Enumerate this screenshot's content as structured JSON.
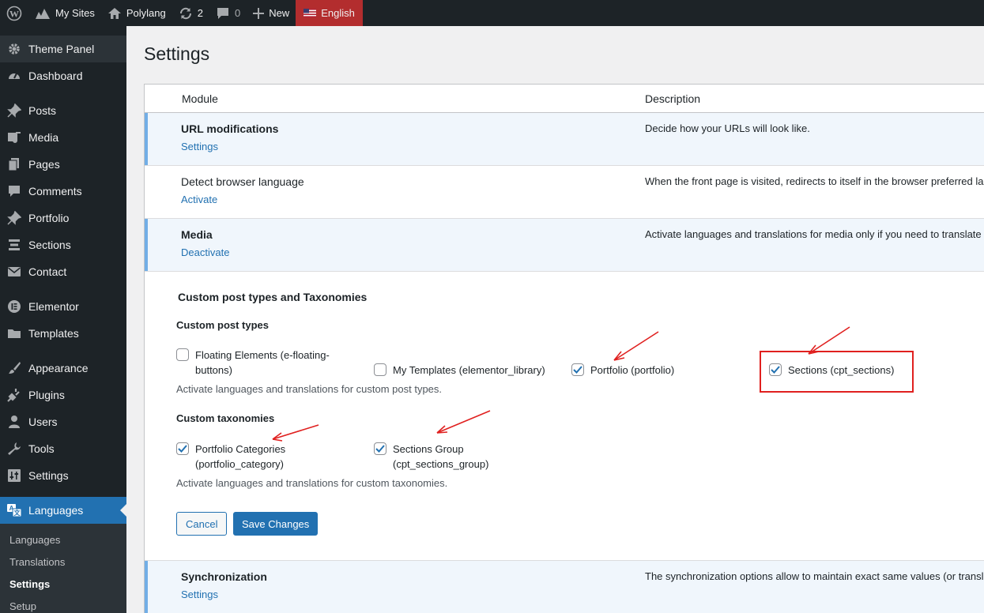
{
  "adminbar": {
    "my_sites": "My Sites",
    "site_name": "Polylang",
    "updates_count": "2",
    "comments_count": "0",
    "new_label": "New",
    "language": "English"
  },
  "sidebar": {
    "items": [
      {
        "label": "Theme Panel",
        "icon": "gear-icon"
      },
      {
        "label": "Dashboard",
        "icon": "dashboard-icon"
      },
      {
        "label": "Posts",
        "icon": "pin-icon"
      },
      {
        "label": "Media",
        "icon": "media-icon"
      },
      {
        "label": "Pages",
        "icon": "pages-icon"
      },
      {
        "label": "Comments",
        "icon": "comment-icon"
      },
      {
        "label": "Portfolio",
        "icon": "pin-icon"
      },
      {
        "label": "Sections",
        "icon": "list-icon"
      },
      {
        "label": "Contact",
        "icon": "mail-icon"
      },
      {
        "label": "Elementor",
        "icon": "elementor-icon"
      },
      {
        "label": "Templates",
        "icon": "folder-icon"
      },
      {
        "label": "Appearance",
        "icon": "brush-icon"
      },
      {
        "label": "Plugins",
        "icon": "plug-icon"
      },
      {
        "label": "Users",
        "icon": "user-icon"
      },
      {
        "label": "Tools",
        "icon": "wrench-icon"
      },
      {
        "label": "Settings",
        "icon": "sliders-icon"
      },
      {
        "label": "Languages",
        "icon": "translate-icon"
      }
    ],
    "submenu": [
      "Languages",
      "Translations",
      "Settings",
      "Setup"
    ]
  },
  "page": {
    "title": "Settings",
    "col_module": "Module",
    "col_description": "Description"
  },
  "modules": [
    {
      "name": "URL modifications",
      "link": "Settings",
      "description": "Decide how your URLs will look like."
    },
    {
      "name": "Detect browser language",
      "link": "Activate",
      "description": "When the front page is visited, redirects to itself in the browser preferred language."
    },
    {
      "name": "Media",
      "link": "Deactivate",
      "description": "Activate languages and translations for media only if you need to translate the text attached to the media"
    }
  ],
  "cpt": {
    "heading": "Custom post types and Taxonomies",
    "post_types_heading": "Custom post types",
    "post_types": [
      {
        "label": "Floating Elements (e-floating-buttons)",
        "checked": false
      },
      {
        "label": "My Templates (elementor_library)",
        "checked": false
      },
      {
        "label": "Portfolio (portfolio)",
        "checked": true
      },
      {
        "label": "Sections (cpt_sections)",
        "checked": true
      }
    ],
    "post_types_help": "Activate languages and translations for custom post types.",
    "taxonomies_heading": "Custom taxonomies",
    "taxonomies": [
      {
        "label": "Portfolio Categories (portfolio_category)",
        "checked": true
      },
      {
        "label": "Sections Group (cpt_sections_group)",
        "checked": true
      }
    ],
    "taxonomies_help": "Activate languages and translations for custom taxonomies.",
    "cancel": "Cancel",
    "save": "Save Changes"
  },
  "sync": {
    "name": "Synchronization",
    "link": "Settings",
    "description": "The synchronization options allow to maintain exact same values (or translations in the case of taxonomies and page parent)"
  },
  "colors": {
    "accent": "#2271b1",
    "annotation": "#e0201f",
    "admin_bar": "#1d2327"
  }
}
